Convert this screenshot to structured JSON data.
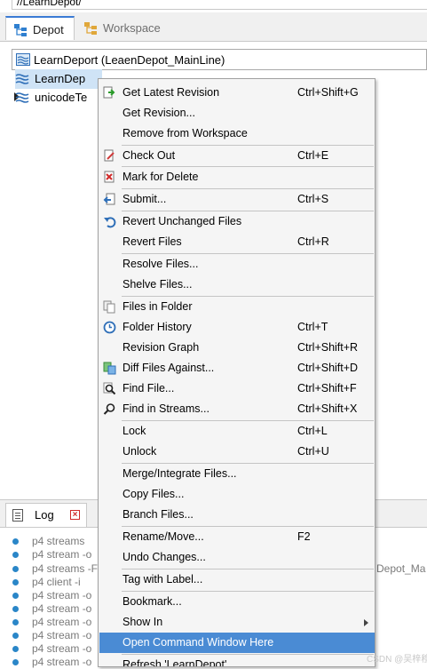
{
  "path_value": "//LearnDepot/",
  "tabs": {
    "depot": "Depot",
    "workspace": "Workspace"
  },
  "depot_selector": "LearnDeport (LeaenDepot_MainLine)",
  "tree": {
    "row1": "LearnDep",
    "row2": "unicodeTe"
  },
  "log": {
    "tab_label": "Log",
    "lines": [
      "p4 streams",
      "p4 stream -o",
      "p4 streams -F",
      "p4 client -i",
      "p4 stream -o",
      "p4 stream -o",
      "p4 stream -o",
      "p4 stream -o",
      "p4 stream -o",
      "p4 stream -o"
    ],
    "tail_text": "Depot_Ma"
  },
  "menu": {
    "get_latest": "Get Latest Revision",
    "get_latest_sc": "Ctrl+Shift+G",
    "get_revision": "Get Revision...",
    "remove_ws": "Remove from Workspace",
    "check_out": "Check Out",
    "check_out_sc": "Ctrl+E",
    "mark_delete": "Mark for Delete",
    "submit": "Submit...",
    "submit_sc": "Ctrl+S",
    "revert_unchanged": "Revert Unchanged Files",
    "revert_files": "Revert Files",
    "revert_files_sc": "Ctrl+R",
    "resolve": "Resolve Files...",
    "shelve": "Shelve Files...",
    "files_in_folder": "Files in Folder",
    "folder_history": "Folder History",
    "folder_history_sc": "Ctrl+T",
    "revision_graph": "Revision Graph",
    "revision_graph_sc": "Ctrl+Shift+R",
    "diff_against": "Diff Files Against...",
    "diff_against_sc": "Ctrl+Shift+D",
    "find_file": "Find File...",
    "find_file_sc": "Ctrl+Shift+F",
    "find_streams": "Find in Streams...",
    "find_streams_sc": "Ctrl+Shift+X",
    "lock": "Lock",
    "lock_sc": "Ctrl+L",
    "unlock": "Unlock",
    "unlock_sc": "Ctrl+U",
    "merge": "Merge/Integrate Files...",
    "copy": "Copy Files...",
    "branch": "Branch Files...",
    "rename": "Rename/Move...",
    "rename_sc": "F2",
    "undo": "Undo Changes...",
    "tag": "Tag with Label...",
    "bookmark": "Bookmark...",
    "show_in": "Show In",
    "open_cmd": "Open Command Window Here",
    "refresh": "Refresh 'LearnDepot'"
  },
  "watermark": "CSDN @吴梓穆",
  "colors": {
    "highlight": "#4a8bd4",
    "selection": "#cfe3f6",
    "log_dot": "#2a86c8"
  }
}
